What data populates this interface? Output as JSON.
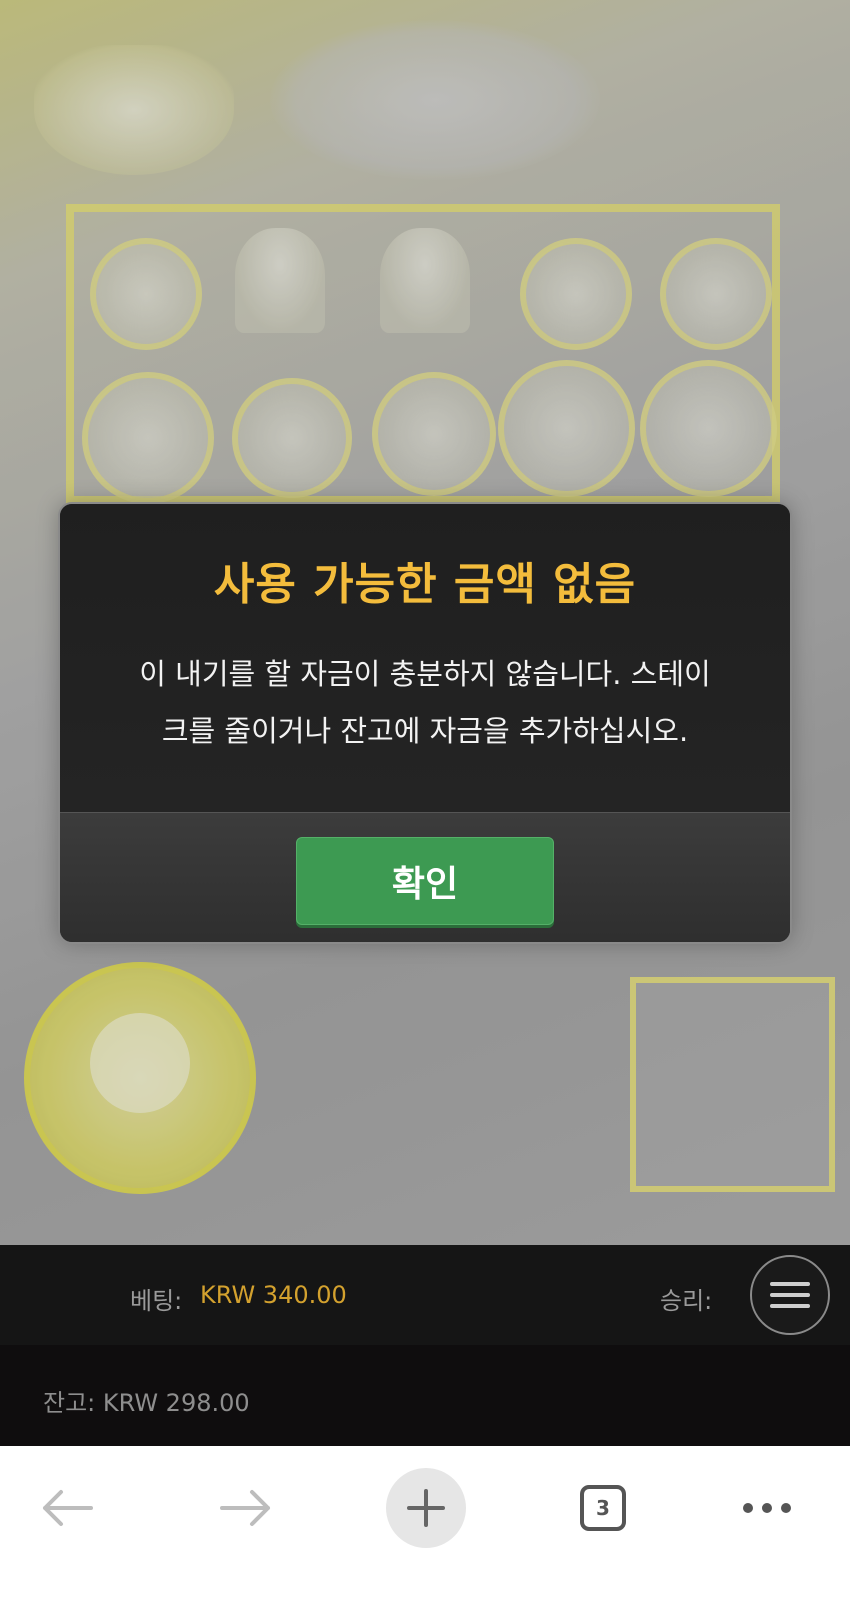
{
  "modal": {
    "title": "사용 가능한 금액 없음",
    "message_line1": "이 내기를 할 자금이 충분하지 않습니다. 스테이",
    "message_line2": "크를 줄이거나 잔고에 자금을 추가하십시오.",
    "confirm_label": "확인"
  },
  "game_bar": {
    "bet_label": "베팅:",
    "bet_value": "KRW 340.00",
    "win_label": "승리:",
    "balance_text": "잔고: KRW 298.00"
  },
  "browser_nav": {
    "tab_count": "3",
    "icons": [
      "back-arrow-icon",
      "forward-arrow-icon",
      "plus-icon",
      "tabs-icon",
      "more-icon"
    ]
  },
  "colors": {
    "title_gold": "#f3bc3c",
    "confirm_green": "#3d9a52",
    "bet_value_gold": "#d3a12e",
    "reel_frame_yellow": "#e8e264"
  }
}
